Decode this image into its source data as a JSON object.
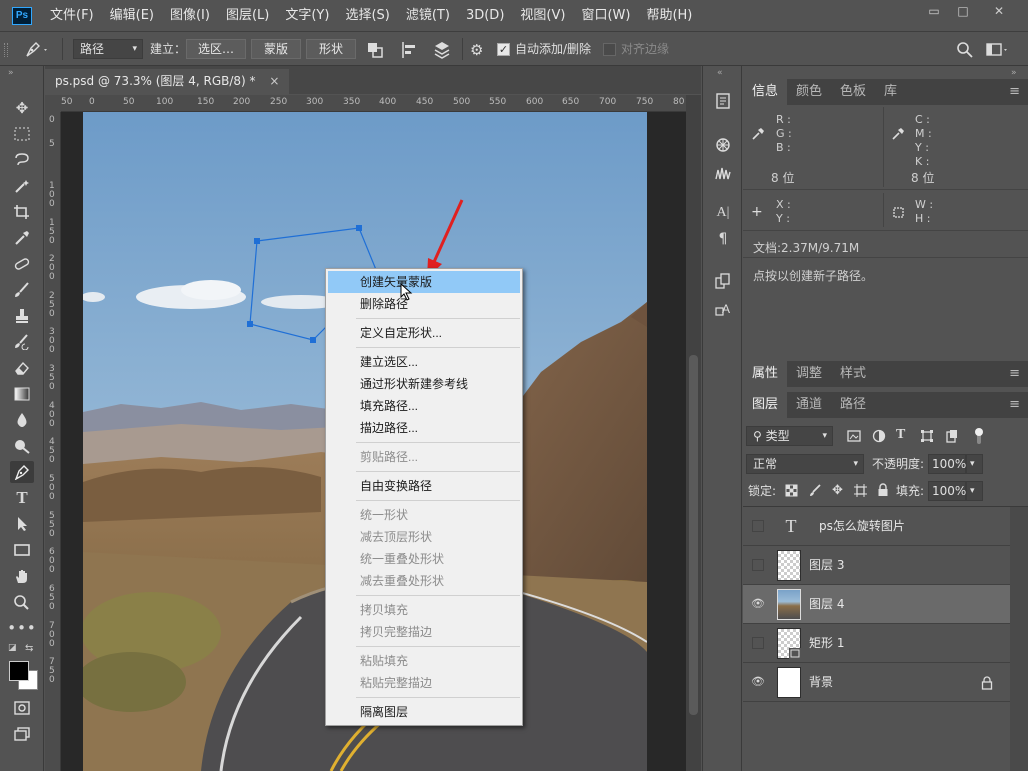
{
  "app": {
    "logo": "Ps"
  },
  "menubar": {
    "items": [
      "文件(F)",
      "编辑(E)",
      "图像(I)",
      "图层(L)",
      "文字(Y)",
      "选择(S)",
      "滤镜(T)",
      "3D(D)",
      "视图(V)",
      "窗口(W)",
      "帮助(H)"
    ],
    "window_controls": [
      "▭",
      "□",
      "✕"
    ]
  },
  "options": {
    "mode_select": "路径",
    "make_label": "建立：",
    "selection_btn": "选区…",
    "mask_btn": "蒙版",
    "shape_btn": "形状",
    "auto_add_delete": "自动添加/删除",
    "align_edges": "对齐边缘"
  },
  "document": {
    "tab_title": "ps.psd @ 73.3% (图层 4, RGB/8) *",
    "close": "×",
    "ruler_h": [
      "50",
      "0",
      "50",
      "100",
      "150",
      "200",
      "250",
      "300",
      "350",
      "400",
      "450",
      "500",
      "550",
      "600",
      "650",
      "700",
      "750",
      "80"
    ],
    "ruler_v": [
      "0",
      "5",
      "1 0 0",
      "1 5 0",
      "2 0 0",
      "2 5 0",
      "3 0 0",
      "3 5 0",
      "4 0 0",
      "4 5 0",
      "5 0 0",
      "5 5 0",
      "6 0 0",
      "6 5 0",
      "7 0 0",
      "7 5 0"
    ]
  },
  "context_menu": {
    "items": [
      {
        "label": "创建矢量蒙版",
        "disabled": false,
        "highlighted": true
      },
      {
        "label": "删除路径",
        "disabled": false
      },
      {
        "label": "定义自定形状...",
        "disabled": false
      },
      {
        "label": "建立选区...",
        "disabled": false
      },
      {
        "label": "通过形状新建参考线",
        "disabled": false
      },
      {
        "label": "填充路径...",
        "disabled": false
      },
      {
        "label": "描边路径...",
        "disabled": false
      },
      {
        "label": "剪贴路径...",
        "disabled": true
      },
      {
        "label": "自由变换路径",
        "disabled": false
      },
      {
        "label": "统一形状",
        "disabled": true
      },
      {
        "label": "减去顶层形状",
        "disabled": true
      },
      {
        "label": "统一重叠处形状",
        "disabled": true
      },
      {
        "label": "减去重叠处形状",
        "disabled": true
      },
      {
        "label": "拷贝填充",
        "disabled": true
      },
      {
        "label": "拷贝完整描边",
        "disabled": true
      },
      {
        "label": "粘贴填充",
        "disabled": true
      },
      {
        "label": "粘贴完整描边",
        "disabled": true
      },
      {
        "label": "隔离图层",
        "disabled": false
      }
    ]
  },
  "info_panel": {
    "tabs": [
      "信息",
      "颜色",
      "色板",
      "库"
    ],
    "rgb": [
      "R :",
      "G :",
      "B :"
    ],
    "cmyk": [
      "C :",
      "M :",
      "Y :",
      "K :"
    ],
    "bit_left": "8 位",
    "bit_right": "8 位",
    "xy": [
      "X :",
      "Y :"
    ],
    "wh": [
      "W :",
      "H :"
    ],
    "doc_size": "文档:2.37M/9.71M",
    "hint": "点按以创建新子路径。"
  },
  "properties_tabs": [
    "属性",
    "调整",
    "样式"
  ],
  "layers_panel": {
    "tabs": [
      "图层",
      "通道",
      "路径"
    ],
    "filter_kind": "类型",
    "blend_mode": "正常",
    "opacity_label": "不透明度:",
    "opacity_value": "100%",
    "lock_label": "锁定:",
    "fill_label": "填充:",
    "fill_value": "100%",
    "layers": [
      {
        "name": "ps怎么旋转图片",
        "type": "text",
        "visible": false
      },
      {
        "name": "图层 3",
        "type": "pixel",
        "visible": false
      },
      {
        "name": "图层 4",
        "type": "photo",
        "visible": true,
        "selected": true
      },
      {
        "name": "矩形 1",
        "type": "shape",
        "visible": false
      },
      {
        "name": "背景",
        "type": "background",
        "visible": true,
        "locked": true
      }
    ]
  },
  "colors": {
    "highlight": "#91c9f7",
    "path": "#1f6fd6",
    "arrow": "#e02020"
  }
}
